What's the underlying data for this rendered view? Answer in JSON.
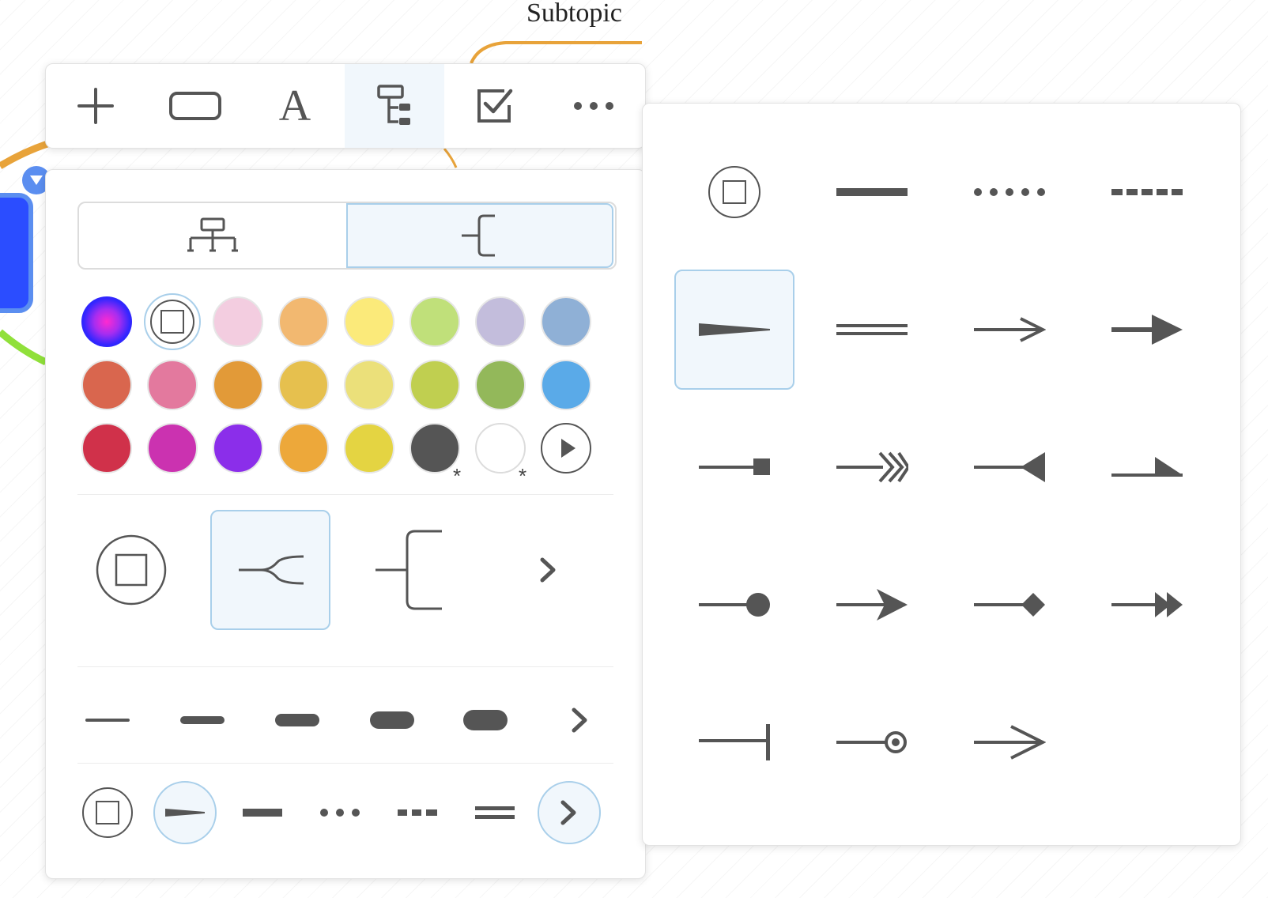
{
  "canvas": {
    "subtopic_label": "Subtopic"
  },
  "toolbar": {
    "buttons": [
      {
        "name": "add",
        "icon": "plus-icon"
      },
      {
        "name": "shape",
        "icon": "rounded-rect-icon"
      },
      {
        "name": "text",
        "icon": "text-icon",
        "glyph": "A"
      },
      {
        "name": "structure",
        "icon": "tree-structure-icon",
        "active": true
      },
      {
        "name": "task",
        "icon": "checkbox-icon"
      },
      {
        "name": "more",
        "icon": "more-icon"
      }
    ]
  },
  "style_panel": {
    "structure_toggle": [
      {
        "name": "org-chart",
        "icon": "org-chart-icon",
        "active": false
      },
      {
        "name": "bracket",
        "icon": "bracket-icon",
        "active": true
      }
    ],
    "colors": [
      [
        "rainbow",
        "none",
        "#f3cde0",
        "#f2b870",
        "#fbea7a",
        "#c0e07a",
        "#c3bddc",
        "#8fb0d6"
      ],
      [
        "#d9664e",
        "#e3799e",
        "#e29a38",
        "#e6c04e",
        "#ebe07a",
        "#c0cf50",
        "#93b85a",
        "#5aaae8"
      ],
      [
        "#d0314a",
        "#cb32b0",
        "#8b2eea",
        "#eda83a",
        "#e4d442",
        "#555555",
        "#ffffff",
        "more"
      ]
    ],
    "line_shapes": [
      {
        "name": "none",
        "icon": "none-square-icon",
        "active": false
      },
      {
        "name": "curve",
        "icon": "curved-branch-icon",
        "active": true
      },
      {
        "name": "bracket",
        "icon": "bracket-line-icon",
        "active": false
      },
      {
        "name": "more",
        "icon": "chevron-right-icon",
        "active": false
      }
    ],
    "thickness": [
      "thin",
      "light",
      "medium",
      "thick",
      "heavy",
      "more"
    ],
    "line_styles": [
      {
        "name": "none",
        "icon": "none-square-icon",
        "active": false
      },
      {
        "name": "taper",
        "icon": "taper-line-icon",
        "active": true
      },
      {
        "name": "solid",
        "icon": "solid-line-icon",
        "active": false
      },
      {
        "name": "dotted",
        "icon": "dotted-line-icon",
        "active": false
      },
      {
        "name": "dashed",
        "icon": "dashed-line-icon",
        "active": false
      },
      {
        "name": "double",
        "icon": "double-line-icon",
        "active": false
      },
      {
        "name": "more",
        "icon": "chevron-right-icon",
        "active": false
      }
    ]
  },
  "end_panel": {
    "options": [
      "none",
      "solid",
      "dotted",
      "dashed",
      "taper",
      "double",
      "open-arrow",
      "filled-arrow",
      "square-end",
      "feather",
      "reverse-triangle",
      "half-arrow",
      "dot-end",
      "arrow",
      "diamond-end",
      "double-arrow",
      "bar-end",
      "ring-end",
      "wide-open-arrow"
    ],
    "selected": "taper"
  },
  "colors": {
    "icon": "#555555",
    "accent": "#a9cfea",
    "accent_bg": "#f1f7fc",
    "branch_orange": "#e8a33a",
    "branch_green": "#90e03a",
    "node_blue": "#2b4dff"
  }
}
